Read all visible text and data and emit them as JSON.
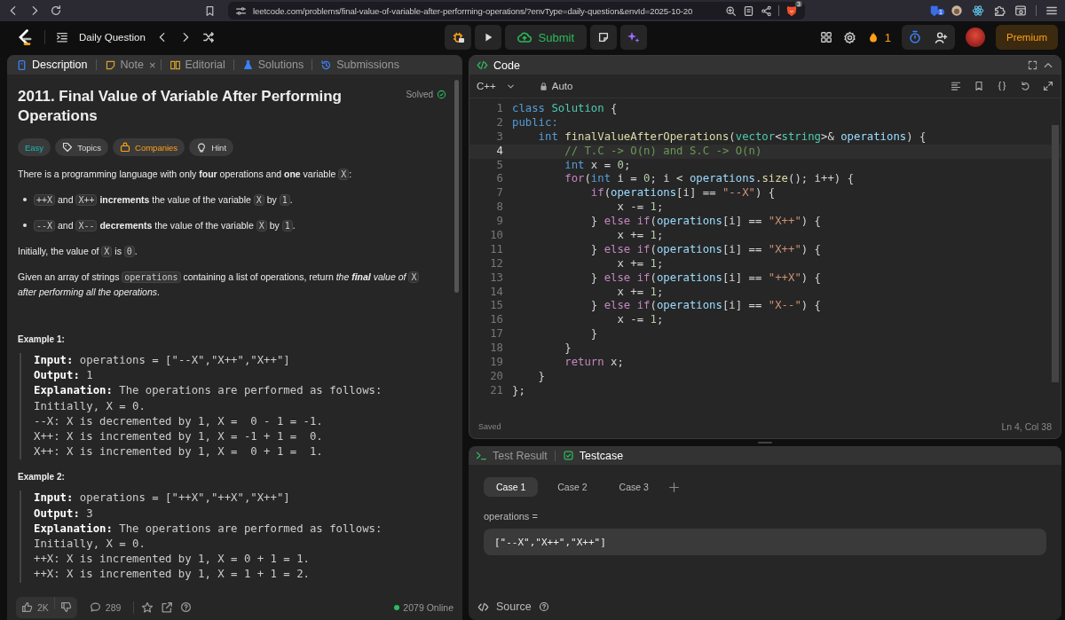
{
  "browser": {
    "url": "leetcode.com/problems/final-value-of-variable-after-performing-operations/?envType=daily-question&envId=2025-10-20",
    "shield_badge": "3",
    "extension_badge": "1"
  },
  "header": {
    "title": "Daily Question",
    "submit": "Submit",
    "streak": "1",
    "premium": "Premium"
  },
  "description_tabs": [
    {
      "label": "Description",
      "selected": true,
      "kind": "description"
    },
    {
      "label": "Note",
      "selected": false,
      "close_label": "×",
      "kind": "note"
    },
    {
      "label": "Editorial",
      "selected": false,
      "kind": "editorial"
    },
    {
      "label": "Solutions",
      "selected": false,
      "kind": "solutions"
    },
    {
      "label": "Submissions",
      "selected": false,
      "kind": "submissions"
    }
  ],
  "problem": {
    "title": "2011. Final Value of Variable After Performing Operations",
    "status": "Solved",
    "tags": [
      {
        "label": "Easy",
        "kind": "difficulty"
      },
      {
        "label": "Topics",
        "kind": "topics"
      },
      {
        "label": "Companies",
        "kind": "companies"
      },
      {
        "label": "Hint",
        "kind": "hint"
      }
    ],
    "paragraphs": [
      {
        "kind": "text",
        "segments": [
          {
            "kind": "text",
            "text": "There is a programming language with only **four** operations and **one** variable "
          },
          {
            "kind": "code",
            "text": "X"
          },
          {
            "kind": "text",
            "text": ":"
          }
        ]
      },
      {
        "kind": "bullet",
        "segments": [
          {
            "kind": "code",
            "text": "++X"
          },
          {
            "kind": "text",
            "text": " and "
          },
          {
            "kind": "code",
            "text": "X++"
          },
          {
            "kind": "text",
            "text": " **increments** the value of the variable "
          },
          {
            "kind": "code",
            "text": "X"
          },
          {
            "kind": "text",
            "text": " by "
          },
          {
            "kind": "code",
            "text": "1"
          },
          {
            "kind": "text",
            "text": "."
          }
        ]
      },
      {
        "kind": "bullet",
        "segments": [
          {
            "kind": "code",
            "text": "--X"
          },
          {
            "kind": "text",
            "text": " and "
          },
          {
            "kind": "code",
            "text": "X--"
          },
          {
            "kind": "text",
            "text": " **decrements** the value of the variable "
          },
          {
            "kind": "code",
            "text": "X"
          },
          {
            "kind": "text",
            "text": " by "
          },
          {
            "kind": "code",
            "text": "1"
          },
          {
            "kind": "text",
            "text": "."
          }
        ]
      },
      {
        "kind": "text",
        "segments": [
          {
            "kind": "text",
            "text": "Initially, the value of "
          },
          {
            "kind": "code",
            "text": "X"
          },
          {
            "kind": "text",
            "text": " is "
          },
          {
            "kind": "code",
            "text": "0"
          },
          {
            "kind": "text",
            "text": "."
          }
        ]
      },
      {
        "kind": "text",
        "segments": [
          {
            "kind": "text",
            "text": "Given an array of strings "
          },
          {
            "kind": "code",
            "text": "operations"
          },
          {
            "kind": "text",
            "text": " containing a list of operations, return "
          },
          {
            "kind": "emphasis",
            "text": "the **final** value of "
          },
          {
            "kind": "code",
            "text": "X"
          },
          {
            "kind": "emphasis",
            "text": " after performing all the operations"
          },
          {
            "kind": "text",
            "text": "."
          }
        ]
      }
    ],
    "examples": [
      {
        "heading": "Example 1:",
        "lines": [
          "**Input:** operations = [\"--X\",\"X++\",\"X++\"]",
          "**Output:** 1",
          "**Explanation:** The operations are performed as follows:",
          "Initially, X = 0.",
          "--X: X is decremented by 1, X =  0 - 1 = -1.",
          "X++: X is incremented by 1, X = -1 + 1 =  0.",
          "X++: X is incremented by 1, X =  0 + 1 =  1."
        ]
      },
      {
        "heading": "Example 2:",
        "lines": [
          "**Input:** operations = [\"++X\",\"++X\",\"X++\"]",
          "**Output:** 3",
          "**Explanation:** The operations are performed as follows:",
          "Initially, X = 0.",
          "++X: X is incremented by 1, X = 0 + 1 = 1.",
          "++X: X is incremented by 1, X = 1 + 1 = 2."
        ]
      }
    ],
    "likes": "2K",
    "comments": "289",
    "online": "2079 Online"
  },
  "code": {
    "title": "Code",
    "language": "C++",
    "mode": "Auto",
    "status": "Saved",
    "cursor": "Ln 4, Col 38",
    "lines": [
      {
        "number": "1",
        "current": false,
        "tokens": [
          {
            "kind": "keyword",
            "text": "class "
          },
          {
            "kind": "type",
            "text": "Solution"
          },
          {
            "kind": "plain",
            "text": " {"
          }
        ]
      },
      {
        "number": "2",
        "current": false,
        "tokens": [
          {
            "kind": "keyword",
            "text": "public:"
          }
        ]
      },
      {
        "number": "3",
        "current": false,
        "tokens": [
          {
            "kind": "keyword",
            "text": "    int "
          },
          {
            "kind": "function",
            "text": "finalValueAfterOperations"
          },
          {
            "kind": "plain",
            "text": "("
          },
          {
            "kind": "type",
            "text": "vector"
          },
          {
            "kind": "plain",
            "text": "<"
          },
          {
            "kind": "type",
            "text": "string"
          },
          {
            "kind": "plain",
            "text": ">& "
          },
          {
            "kind": "variable",
            "text": "operations"
          },
          {
            "kind": "plain",
            "text": ") {"
          }
        ]
      },
      {
        "number": "4",
        "current": true,
        "tokens": [
          {
            "kind": "comment",
            "text": "        // T.C -> O(n) and S.C -> O(n)"
          }
        ]
      },
      {
        "number": "5",
        "current": false,
        "tokens": [
          {
            "kind": "keyword",
            "text": "        int"
          },
          {
            "kind": "plain",
            "text": " x = "
          },
          {
            "kind": "number",
            "text": "0"
          },
          {
            "kind": "plain",
            "text": ";"
          }
        ]
      },
      {
        "number": "6",
        "current": false,
        "tokens": [
          {
            "kind": "control",
            "text": "        for"
          },
          {
            "kind": "plain",
            "text": "("
          },
          {
            "kind": "keyword",
            "text": "int"
          },
          {
            "kind": "plain",
            "text": " i = "
          },
          {
            "kind": "number",
            "text": "0"
          },
          {
            "kind": "plain",
            "text": "; i < "
          },
          {
            "kind": "variable",
            "text": "operations"
          },
          {
            "kind": "plain",
            "text": "."
          },
          {
            "kind": "function",
            "text": "size"
          },
          {
            "kind": "plain",
            "text": "(); i++) {"
          }
        ]
      },
      {
        "number": "7",
        "current": false,
        "tokens": [
          {
            "kind": "control",
            "text": "            if"
          },
          {
            "kind": "plain",
            "text": "("
          },
          {
            "kind": "variable",
            "text": "operations"
          },
          {
            "kind": "plain",
            "text": "[i] == "
          },
          {
            "kind": "string",
            "text": "\"--X\""
          },
          {
            "kind": "plain",
            "text": ") {"
          }
        ]
      },
      {
        "number": "8",
        "current": false,
        "tokens": [
          {
            "kind": "plain",
            "text": "                x -= "
          },
          {
            "kind": "number",
            "text": "1"
          },
          {
            "kind": "plain",
            "text": ";"
          }
        ]
      },
      {
        "number": "9",
        "current": false,
        "tokens": [
          {
            "kind": "plain",
            "text": "            } "
          },
          {
            "kind": "control",
            "text": "else if"
          },
          {
            "kind": "plain",
            "text": "("
          },
          {
            "kind": "variable",
            "text": "operations"
          },
          {
            "kind": "plain",
            "text": "[i] == "
          },
          {
            "kind": "string",
            "text": "\"X++\""
          },
          {
            "kind": "plain",
            "text": ") {"
          }
        ]
      },
      {
        "number": "10",
        "current": false,
        "tokens": [
          {
            "kind": "plain",
            "text": "                x += "
          },
          {
            "kind": "number",
            "text": "1"
          },
          {
            "kind": "plain",
            "text": ";"
          }
        ]
      },
      {
        "number": "11",
        "current": false,
        "tokens": [
          {
            "kind": "plain",
            "text": "            } "
          },
          {
            "kind": "control",
            "text": "else if"
          },
          {
            "kind": "plain",
            "text": "("
          },
          {
            "kind": "variable",
            "text": "operations"
          },
          {
            "kind": "plain",
            "text": "[i] == "
          },
          {
            "kind": "string",
            "text": "\"X++\""
          },
          {
            "kind": "plain",
            "text": ") {"
          }
        ]
      },
      {
        "number": "12",
        "current": false,
        "tokens": [
          {
            "kind": "plain",
            "text": "                x += "
          },
          {
            "kind": "number",
            "text": "1"
          },
          {
            "kind": "plain",
            "text": ";"
          }
        ]
      },
      {
        "number": "13",
        "current": false,
        "tokens": [
          {
            "kind": "plain",
            "text": "            } "
          },
          {
            "kind": "control",
            "text": "else if"
          },
          {
            "kind": "plain",
            "text": "("
          },
          {
            "kind": "variable",
            "text": "operations"
          },
          {
            "kind": "plain",
            "text": "[i] == "
          },
          {
            "kind": "string",
            "text": "\"++X\""
          },
          {
            "kind": "plain",
            "text": ") {"
          }
        ]
      },
      {
        "number": "14",
        "current": false,
        "tokens": [
          {
            "kind": "plain",
            "text": "                x += "
          },
          {
            "kind": "number",
            "text": "1"
          },
          {
            "kind": "plain",
            "text": ";"
          }
        ]
      },
      {
        "number": "15",
        "current": false,
        "tokens": [
          {
            "kind": "plain",
            "text": "            } "
          },
          {
            "kind": "control",
            "text": "else if"
          },
          {
            "kind": "plain",
            "text": "("
          },
          {
            "kind": "variable",
            "text": "operations"
          },
          {
            "kind": "plain",
            "text": "[i] == "
          },
          {
            "kind": "string",
            "text": "\"X--\""
          },
          {
            "kind": "plain",
            "text": ") {"
          }
        ]
      },
      {
        "number": "16",
        "current": false,
        "tokens": [
          {
            "kind": "plain",
            "text": "                x -= "
          },
          {
            "kind": "number",
            "text": "1"
          },
          {
            "kind": "plain",
            "text": ";"
          }
        ]
      },
      {
        "number": "17",
        "current": false,
        "tokens": [
          {
            "kind": "plain",
            "text": "            }"
          }
        ]
      },
      {
        "number": "18",
        "current": false,
        "tokens": [
          {
            "kind": "plain",
            "text": "        }"
          }
        ]
      },
      {
        "number": "19",
        "current": false,
        "tokens": [
          {
            "kind": "control",
            "text": "        return"
          },
          {
            "kind": "plain",
            "text": " x;"
          }
        ]
      },
      {
        "number": "20",
        "current": false,
        "tokens": [
          {
            "kind": "plain",
            "text": "    }"
          }
        ]
      },
      {
        "number": "21",
        "current": false,
        "tokens": [
          {
            "kind": "plain",
            "text": "};"
          }
        ]
      }
    ]
  },
  "test_panel": {
    "tabs": [
      {
        "label": "Test Result",
        "selected": false,
        "kind": "result"
      },
      {
        "label": "Testcase",
        "selected": true,
        "kind": "testcase"
      }
    ],
    "cases": [
      {
        "label": "Case 1",
        "selected": true
      },
      {
        "label": "Case 2",
        "selected": false
      },
      {
        "label": "Case 3",
        "selected": false
      }
    ],
    "parameter": "operations =",
    "value": "[\"--X\",\"X++\",\"X++\"]",
    "source": "Source"
  }
}
